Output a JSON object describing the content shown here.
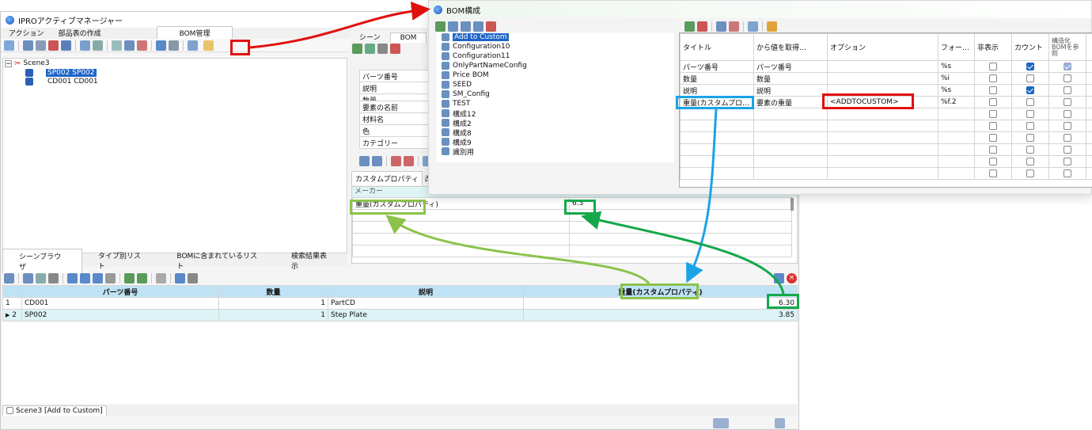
{
  "main_window": {
    "title": "IPROアクティブマネージャー",
    "ribbon_tabs": [
      "アクション",
      "部品表の作成",
      "BOM管理"
    ],
    "tree": {
      "root": "Scene3",
      "items": [
        "SP002 SP002",
        "CD001 CD001"
      ]
    },
    "center_tabs": [
      "シーン",
      "BOM"
    ],
    "props_group1": [
      "パーツ番号",
      "説明",
      "数量"
    ],
    "props_group2": [
      "要素の名前",
      "材料名",
      "色",
      "カテゴリー"
    ],
    "subtabs": [
      "カスタムプロパティ",
      "改訂履"
    ],
    "custom_props": {
      "header": "メーカー",
      "row_label": "重量(カスタムプロパティ)",
      "row_value": "6.3"
    },
    "bottom_tabs": [
      "シーンブラウザ",
      "タイプ別リスト",
      "BOMに含まれているリスト",
      "検索結果表示"
    ],
    "grid": {
      "columns": [
        "パーツ番号",
        "数量",
        "説明",
        "重量(カスタムプロパティ)"
      ],
      "rows": [
        {
          "idx": "1",
          "part": "CD001",
          "qty": "1",
          "desc": "PartCD",
          "weight": "6.30"
        },
        {
          "idx": "2",
          "part": "SP002",
          "qty": "1",
          "desc": "Step Plate",
          "weight": "3.85"
        }
      ]
    },
    "status": "Scene3 [Add to Custom]"
  },
  "bom_window": {
    "title": "BOM構成",
    "configs": [
      "Add to Custom",
      "Configuration10",
      "Configuration11",
      "OnlyPartNameConfig",
      "Price BOM",
      "SEED",
      "SM_Config",
      "TEST",
      "構成12",
      "構成2",
      "構成8",
      "構成9",
      "識別用"
    ],
    "columns": [
      "タイトル",
      "から値を取得…",
      "オプション",
      "フォーマット",
      "非表示",
      "カウント",
      "構造化BOMを参照"
    ],
    "rows": [
      {
        "title": "パーツ番号",
        "source": "パーツ番号",
        "option": "",
        "format": "%s",
        "hidden": false,
        "count": true,
        "struct": "on-disabled"
      },
      {
        "title": "数量",
        "source": "数量",
        "option": "",
        "format": "%i",
        "hidden": false,
        "count": false,
        "struct": "off"
      },
      {
        "title": "説明",
        "source": "説明",
        "option": "",
        "format": "%s",
        "hidden": false,
        "count": true,
        "struct": "off"
      },
      {
        "title": "重量(カスタムプロパティ)",
        "source": "要素の重量",
        "option": "<ADDTOCUSTOM>",
        "format": "%f.2",
        "hidden": false,
        "count": false,
        "struct": "off"
      }
    ],
    "empty_rows": 6
  },
  "colors": {
    "red": "#e01010",
    "blue": "#1aa3e6",
    "green": "#14a84a",
    "lightgreen": "#8bc34a",
    "selection": "#1e66c8"
  }
}
